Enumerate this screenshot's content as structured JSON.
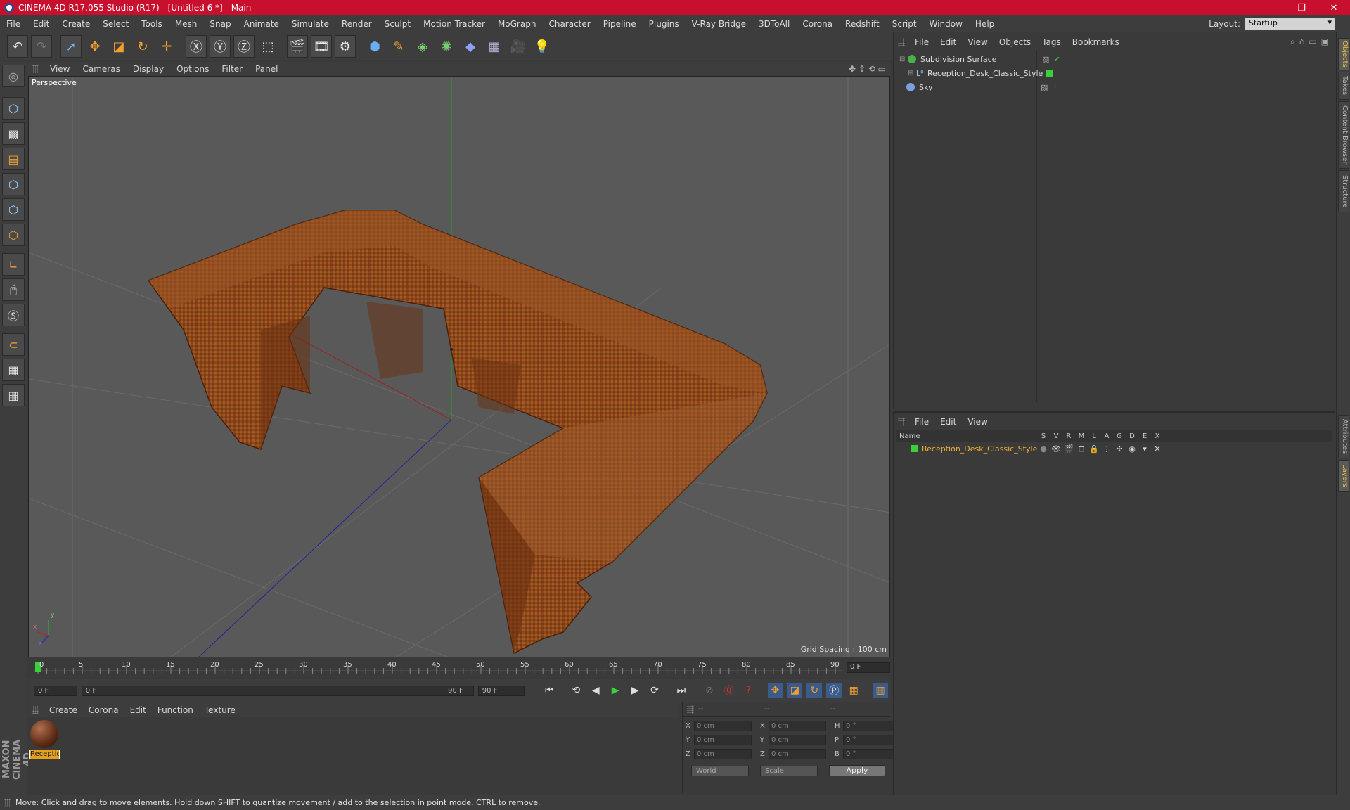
{
  "window": {
    "title": "CINEMA 4D R17.055 Studio (R17) - [Untitled 6 *] - Main",
    "minimize": "–",
    "maximize": "❐",
    "close": "✕"
  },
  "menubar": {
    "items": [
      "File",
      "Edit",
      "Create",
      "Select",
      "Tools",
      "Mesh",
      "Snap",
      "Animate",
      "Simulate",
      "Render",
      "Sculpt",
      "Motion Tracker",
      "MoGraph",
      "Character",
      "Pipeline",
      "Plugins",
      "V-Ray Bridge",
      "3DToAll",
      "Corona",
      "Redshift",
      "Script",
      "Window",
      "Help"
    ],
    "layout_label": "Layout:",
    "layout_value": "Startup"
  },
  "viewport": {
    "menu": [
      "View",
      "Cameras",
      "Display",
      "Options",
      "Filter",
      "Panel"
    ],
    "label": "Perspective",
    "grid_spacing": "Grid Spacing : 100 cm",
    "axis_x": "x",
    "axis_y": "y",
    "axis_z": "z"
  },
  "timeline": {
    "ticks": [
      "0",
      "5",
      "10",
      "15",
      "20",
      "25",
      "30",
      "35",
      "40",
      "45",
      "50",
      "55",
      "60",
      "65",
      "70",
      "75",
      "80",
      "85",
      "90"
    ],
    "current_frame": "0 F",
    "start_field": "0 F",
    "range_start": "0 F",
    "range_end": "90 F",
    "end_field": "90 F"
  },
  "material_manager": {
    "menu": [
      "Create",
      "Corona",
      "Edit",
      "Function",
      "Texture"
    ],
    "material_name": "Reception_Desk_Classic_Style"
  },
  "coordinates": {
    "header": [
      "--",
      "--",
      "--"
    ],
    "rows": [
      {
        "l1": "X",
        "v1": "0 cm",
        "l2": "X",
        "v2": "0 cm",
        "l3": "H",
        "v3": "0 °"
      },
      {
        "l1": "Y",
        "v1": "0 cm",
        "l2": "Y",
        "v2": "0 cm",
        "l3": "P",
        "v3": "0 °"
      },
      {
        "l1": "Z",
        "v1": "0 cm",
        "l2": "Z",
        "v2": "0 cm",
        "l3": "B",
        "v3": "0 °"
      }
    ],
    "mode1": "World",
    "mode2": "Scale",
    "apply": "Apply"
  },
  "object_manager": {
    "menu": [
      "File",
      "Edit",
      "View",
      "Objects",
      "Tags",
      "Bookmarks"
    ],
    "objects": [
      {
        "name": "Subdivision Surface"
      },
      {
        "name": "Reception_Desk_Classic_Style"
      },
      {
        "name": "Sky"
      }
    ]
  },
  "layer_manager": {
    "menu": [
      "File",
      "Edit",
      "View"
    ],
    "columns": [
      "Name",
      "S",
      "V",
      "R",
      "M",
      "L",
      "A",
      "G",
      "D",
      "E",
      "X"
    ],
    "layer_name": "Reception_Desk_Classic_Style"
  },
  "right_tabs": [
    "Objects",
    "Takes",
    "Content Browser",
    "Structure",
    "Attributes",
    "Layers"
  ],
  "status": "Move: Click and drag to move elements. Hold down SHIFT to quantize movement / add to the selection in point mode, CTRL to remove.",
  "branding": "MAXON CINEMA 4D",
  "colors": {
    "title_bar": "#c8102e",
    "accent": "#e6a01e",
    "layer_text": "#f0b030",
    "desk": "#8a4a1a"
  }
}
